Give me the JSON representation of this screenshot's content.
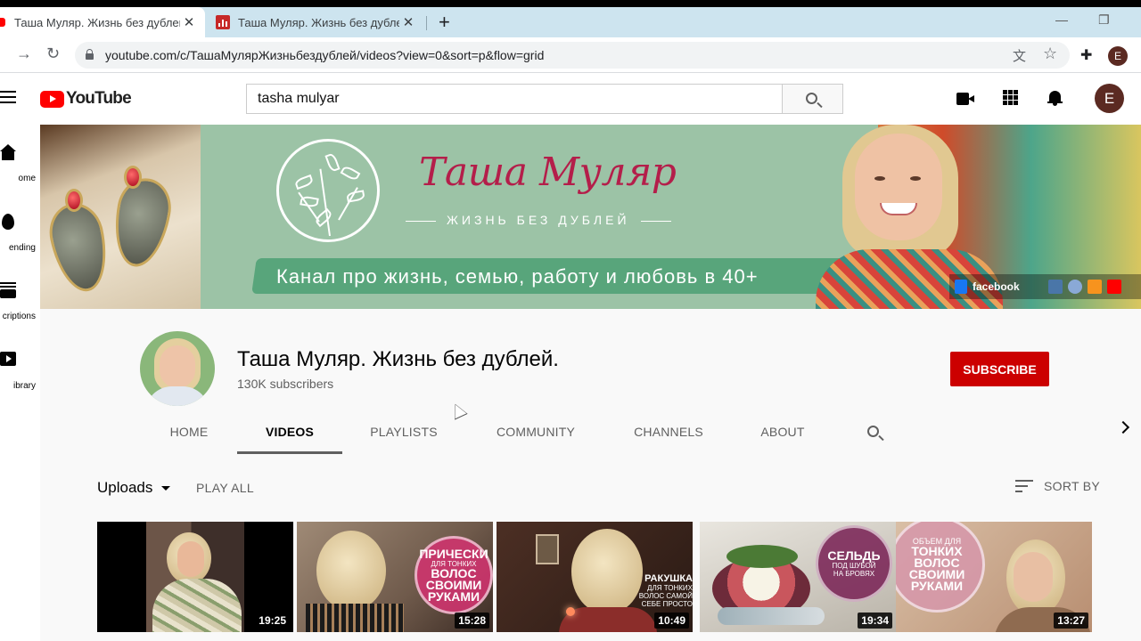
{
  "browser": {
    "tabs": [
      {
        "title": "Таша Муляр. Жизнь без дублей",
        "active": true
      },
      {
        "title": "Таша Муляр. Жизнь без дублей",
        "active": false
      }
    ],
    "new_tab_symbol": "+",
    "close_symbol": "✕",
    "window_minimize": "—",
    "window_restore": "❐",
    "back_symbol": "→",
    "reload_symbol": "↻",
    "url": "youtube.com/c/ТашаМулярЖизньбездублей/videos?view=0&sort=p&flow=grid",
    "translate_icon": "文",
    "bookmark_icon": "☆",
    "extension_icon": "✚",
    "profile_initial": "E"
  },
  "masthead": {
    "logo_text": "YouTube",
    "search_value": "tasha mulyar",
    "avatar_initial": "E"
  },
  "guide": {
    "items": [
      {
        "label": "Home",
        "shown": "ome",
        "icon": "home-icon"
      },
      {
        "label": "Trending",
        "shown": "ending",
        "icon": "flame-icon"
      },
      {
        "label": "Subscriptions",
        "shown": "criptions",
        "icon": "subscriptions-icon"
      },
      {
        "label": "Library",
        "shown": "ibrary",
        "icon": "library-icon"
      }
    ]
  },
  "banner": {
    "title": "Таша Муляр",
    "subtitle": "ЖИЗНЬ БЕЗ ДУБЛЕЙ",
    "tagline": "Канал про жизнь, семью, работу и любовь в 40+",
    "social_label": "facebook",
    "colors": {
      "green": "#9cc3a6",
      "title": "#b41e4a"
    }
  },
  "channel": {
    "name": "Таша Муляр. Жизнь без дублей.",
    "subscribers": "130K subscribers",
    "subscribe_label": "SUBSCRIBE",
    "subscribe_color": "#cc0000",
    "tabs": [
      "HOME",
      "VIDEOS",
      "PLAYLISTS",
      "COMMUNITY",
      "CHANNELS",
      "ABOUT"
    ],
    "selected_tab": "VIDEOS"
  },
  "content": {
    "uploads_label": "Uploads",
    "play_all_label": "PLAY ALL",
    "sort_by_label": "SORT BY",
    "videos": [
      {
        "duration": "19:25",
        "overlay": []
      },
      {
        "duration": "15:28",
        "overlay": [
          "ПРИЧЕСКИ",
          "ДЛЯ ТОНКИХ",
          "ВОЛОС",
          "СВОИМИ",
          "РУКАМИ"
        ]
      },
      {
        "duration": "10:49",
        "overlay": [
          "РАКУШКА",
          "ДЛЯ ТОНКИХ",
          "ВОЛОС САМОЙ",
          "СЕБЕ ПРОСТО"
        ]
      },
      {
        "duration": "19:34",
        "overlay": [
          "СЕЛЬДЬ",
          "ПОД ШУБОЙ",
          "НА БРОВЯХ"
        ]
      },
      {
        "duration": "13:27",
        "overlay": [
          "ОБЪЕМ ДЛЯ",
          "ТОНКИХ",
          "ВОЛОС",
          "СВОИМИ",
          "РУКАМИ"
        ]
      }
    ]
  }
}
